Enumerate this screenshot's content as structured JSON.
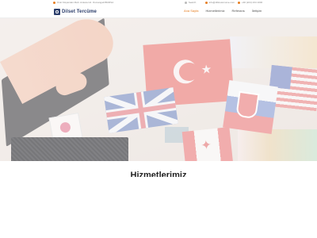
{
  "topbar": {
    "address": "Ümit Kılıçarslan Mah. Ankara Cd. Osmangazi/BURSA",
    "search_label": "Search",
    "email": "info@diltcetercume.com",
    "phone": "+90 (224) 234 1000",
    "icon_color": "#e67e22"
  },
  "header": {
    "logo_text": "Dilset Tercüme",
    "nav": [
      {
        "label": "Ana Sayfa",
        "active": true
      },
      {
        "label": "Hizmetlerimiz",
        "active": false
      },
      {
        "label": "Referans",
        "active": false
      },
      {
        "label": "İletişim",
        "active": false
      }
    ]
  },
  "hero": {
    "image": "hand-opening-box-with-world-flags"
  },
  "section": {
    "title": "Hizmetlerimiz"
  },
  "colors": {
    "accent": "#e67e22",
    "brand": "#2c3e6b"
  }
}
